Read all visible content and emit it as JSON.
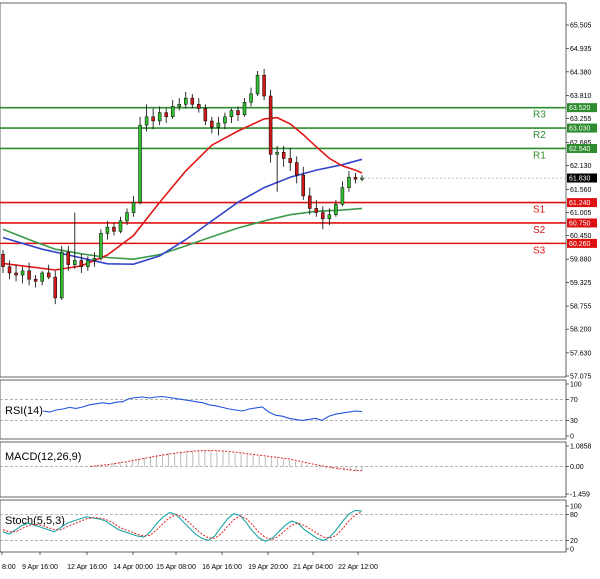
{
  "chart_data": {
    "type": "candlestick",
    "price_axis": {
      "ticks": [
        "65.505",
        "64.935",
        "64.380",
        "63.810",
        "63.255",
        "62.685",
        "62.130",
        "61.560",
        "61.005",
        "60.450",
        "59.880",
        "59.325",
        "58.755",
        "58.200",
        "57.630",
        "57.075"
      ],
      "ylim": [
        57.075,
        65.505
      ],
      "current_price": "61.830"
    },
    "time_axis": {
      "ticks": [
        "8:00",
        "9 Apr 16:00",
        "12 Apr 16:00",
        "14 Apr 00:00",
        "15 Apr 08:00",
        "16 Apr 16:00",
        "19 Apr 20:00",
        "21 Apr 04:00",
        "22 Apr 12:00"
      ]
    },
    "levels": [
      {
        "label": "R3",
        "value": "63.520",
        "color": "#2e8b2e"
      },
      {
        "label": "R2",
        "value": "63.030",
        "color": "#2e8b2e"
      },
      {
        "label": "R1",
        "value": "62.540",
        "color": "#2e8b2e"
      },
      {
        "label": "S1",
        "value": "61.240",
        "color": "#dd1111"
      },
      {
        "label": "S2",
        "value": "60.750",
        "color": "#dd1111"
      },
      {
        "label": "S3",
        "value": "60.260",
        "color": "#dd1111"
      }
    ],
    "candles": [
      [
        60.0,
        60.1,
        59.55,
        59.7
      ],
      [
        59.7,
        59.85,
        59.4,
        59.55
      ],
      [
        59.55,
        59.75,
        59.35,
        59.5
      ],
      [
        59.5,
        59.7,
        59.3,
        59.6
      ],
      [
        59.6,
        59.8,
        59.25,
        59.4
      ],
      [
        59.4,
        59.5,
        59.2,
        59.35
      ],
      [
        59.35,
        59.6,
        59.25,
        59.55
      ],
      [
        59.55,
        59.75,
        59.4,
        59.45
      ],
      [
        59.45,
        59.6,
        58.8,
        58.95
      ],
      [
        58.95,
        60.2,
        58.9,
        60.05
      ],
      [
        60.05,
        60.2,
        59.6,
        59.75
      ],
      [
        59.75,
        61.0,
        59.65,
        59.85
      ],
      [
        59.85,
        60.0,
        59.55,
        59.7
      ],
      [
        59.7,
        59.95,
        59.6,
        59.85
      ],
      [
        59.85,
        60.05,
        59.7,
        59.9
      ],
      [
        59.9,
        60.6,
        59.85,
        60.5
      ],
      [
        60.5,
        60.8,
        60.35,
        60.65
      ],
      [
        60.65,
        60.75,
        60.45,
        60.55
      ],
      [
        60.55,
        60.9,
        60.5,
        60.8
      ],
      [
        60.8,
        61.1,
        60.7,
        61.0
      ],
      [
        61.0,
        61.4,
        60.9,
        61.25
      ],
      [
        61.25,
        63.3,
        61.2,
        63.1
      ],
      [
        63.1,
        63.6,
        62.95,
        63.3
      ],
      [
        63.3,
        63.5,
        63.0,
        63.2
      ],
      [
        63.2,
        63.55,
        63.1,
        63.4
      ],
      [
        63.4,
        63.5,
        63.15,
        63.3
      ],
      [
        63.3,
        63.7,
        63.25,
        63.55
      ],
      [
        63.55,
        63.75,
        63.45,
        63.6
      ],
      [
        63.6,
        63.9,
        63.5,
        63.75
      ],
      [
        63.75,
        63.85,
        63.5,
        63.6
      ],
      [
        63.6,
        63.75,
        63.4,
        63.5
      ],
      [
        63.5,
        63.6,
        63.1,
        63.2
      ],
      [
        63.2,
        63.3,
        62.9,
        63.05
      ],
      [
        63.05,
        63.3,
        62.85,
        63.15
      ],
      [
        63.15,
        63.4,
        63.0,
        63.3
      ],
      [
        63.3,
        63.5,
        63.15,
        63.45
      ],
      [
        63.45,
        63.55,
        63.2,
        63.35
      ],
      [
        63.35,
        63.75,
        63.3,
        63.65
      ],
      [
        63.65,
        64.0,
        63.55,
        63.85
      ],
      [
        63.85,
        64.4,
        63.8,
        64.3
      ],
      [
        64.3,
        64.45,
        63.7,
        63.8
      ],
      [
        63.8,
        63.95,
        62.2,
        62.4
      ],
      [
        62.4,
        62.6,
        61.5,
        62.45
      ],
      [
        62.45,
        62.6,
        62.1,
        62.3
      ],
      [
        62.3,
        62.55,
        62.0,
        62.2
      ],
      [
        62.2,
        62.35,
        61.7,
        61.9
      ],
      [
        61.9,
        62.1,
        61.3,
        61.4
      ],
      [
        61.4,
        61.6,
        60.95,
        61.1
      ],
      [
        61.1,
        61.3,
        60.9,
        61.0
      ],
      [
        61.0,
        61.15,
        60.6,
        60.85
      ],
      [
        60.85,
        61.1,
        60.7,
        60.95
      ],
      [
        60.95,
        61.3,
        60.9,
        61.2
      ],
      [
        61.2,
        61.75,
        61.15,
        61.6
      ],
      [
        61.6,
        62.0,
        61.5,
        61.85
      ],
      [
        61.85,
        61.95,
        61.7,
        61.8
      ],
      [
        61.8,
        61.9,
        61.75,
        61.83
      ]
    ],
    "ma_red": [
      [
        0,
        59.78
      ],
      [
        8,
        59.62
      ],
      [
        12,
        59.72
      ],
      [
        16,
        59.98
      ],
      [
        20,
        60.45
      ],
      [
        24,
        61.25
      ],
      [
        28,
        62.0
      ],
      [
        32,
        62.62
      ],
      [
        36,
        62.96
      ],
      [
        40,
        63.25
      ],
      [
        42,
        63.28
      ],
      [
        44,
        63.13
      ],
      [
        46,
        62.87
      ],
      [
        48,
        62.58
      ],
      [
        50,
        62.3
      ],
      [
        52,
        62.12
      ],
      [
        54,
        62.02
      ],
      [
        55,
        61.95
      ]
    ],
    "ma_blue": [
      [
        0,
        60.4
      ],
      [
        6,
        60.12
      ],
      [
        10,
        59.98
      ],
      [
        16,
        59.77
      ],
      [
        20,
        59.76
      ],
      [
        24,
        59.96
      ],
      [
        28,
        60.35
      ],
      [
        32,
        60.8
      ],
      [
        36,
        61.25
      ],
      [
        40,
        61.6
      ],
      [
        44,
        61.85
      ],
      [
        48,
        62.02
      ],
      [
        52,
        62.15
      ],
      [
        55,
        62.28
      ]
    ],
    "ma_green": [
      [
        0,
        60.6
      ],
      [
        4,
        60.35
      ],
      [
        8,
        60.12
      ],
      [
        12,
        60.01
      ],
      [
        16,
        59.92
      ],
      [
        20,
        59.88
      ],
      [
        24,
        59.99
      ],
      [
        28,
        60.2
      ],
      [
        32,
        60.42
      ],
      [
        36,
        60.63
      ],
      [
        40,
        60.8
      ],
      [
        44,
        60.95
      ],
      [
        48,
        61.03
      ],
      [
        52,
        61.06
      ],
      [
        55,
        61.1
      ]
    ],
    "rsi": {
      "title": "RSI(14)",
      "ticks": [
        "100",
        "70",
        "30",
        "0"
      ],
      "ylim": [
        0,
        100
      ],
      "values": [
        48,
        46,
        50,
        52,
        55,
        53,
        56,
        60,
        62,
        64,
        62,
        65,
        66,
        72,
        74,
        75,
        73,
        75,
        76,
        74,
        72,
        70,
        68,
        66,
        64,
        60,
        58,
        55,
        52,
        50,
        48,
        52,
        54,
        56,
        46,
        40,
        38,
        34,
        32,
        30,
        32,
        34,
        30,
        38,
        42,
        44,
        46,
        48,
        47
      ]
    },
    "macd": {
      "title": "MACD(12,26,9)",
      "ticks": [
        "1.0858",
        "0.00",
        "-1.459"
      ],
      "ylim": [
        -1.459,
        1.0858
      ],
      "hist": [
        0.0,
        0.05,
        0.1,
        0.12,
        0.18,
        0.22,
        0.28,
        0.34,
        0.4,
        0.46,
        0.52,
        0.6,
        0.65,
        0.7,
        0.74,
        0.78,
        0.82,
        0.84,
        0.86,
        0.85,
        0.84,
        0.83,
        0.8,
        0.76,
        0.72,
        0.68,
        0.64,
        0.6,
        0.56,
        0.52,
        0.48,
        0.44,
        0.4,
        0.34,
        0.26,
        0.18,
        0.1,
        0.02,
        -0.06,
        -0.1,
        -0.14,
        -0.18,
        -0.22,
        -0.24,
        -0.25,
        -0.26
      ],
      "signal": [
        0.0,
        0.03,
        0.07,
        0.1,
        0.15,
        0.2,
        0.25,
        0.31,
        0.37,
        0.43,
        0.49,
        0.55,
        0.6,
        0.65,
        0.7,
        0.74,
        0.78,
        0.81,
        0.83,
        0.84,
        0.84,
        0.84,
        0.82,
        0.79,
        0.76,
        0.72,
        0.68,
        0.64,
        0.6,
        0.56,
        0.52,
        0.48,
        0.44,
        0.39,
        0.33,
        0.26,
        0.19,
        0.12,
        0.05,
        0.0,
        -0.05,
        -0.1,
        -0.14,
        -0.18,
        -0.21,
        -0.23
      ]
    },
    "stoch": {
      "title": "Stoch(5,5,3)",
      "ticks": [
        "100",
        "80",
        "20",
        "0"
      ],
      "ylim": [
        0,
        100
      ],
      "k": [
        40,
        35,
        45,
        55,
        60,
        55,
        50,
        45,
        40,
        50,
        60,
        65,
        70,
        75,
        72,
        70,
        65,
        55,
        45,
        40,
        35,
        30,
        28,
        40,
        60,
        75,
        85,
        80,
        65,
        50,
        35,
        25,
        20,
        30,
        50,
        70,
        82,
        78,
        60,
        40,
        25,
        18,
        25,
        40,
        55,
        65,
        60,
        45,
        35,
        25,
        20,
        28,
        45,
        65,
        82,
        90,
        88
      ],
      "d": [
        45,
        40,
        40,
        48,
        55,
        58,
        55,
        50,
        45,
        45,
        52,
        58,
        64,
        70,
        73,
        72,
        69,
        62,
        52,
        45,
        40,
        34,
        30,
        32,
        45,
        60,
        73,
        80,
        75,
        62,
        48,
        35,
        26,
        25,
        35,
        52,
        68,
        77,
        70,
        55,
        38,
        26,
        22,
        30,
        43,
        55,
        60,
        55,
        46,
        36,
        28,
        25,
        32,
        48,
        66,
        80,
        86
      ]
    }
  }
}
